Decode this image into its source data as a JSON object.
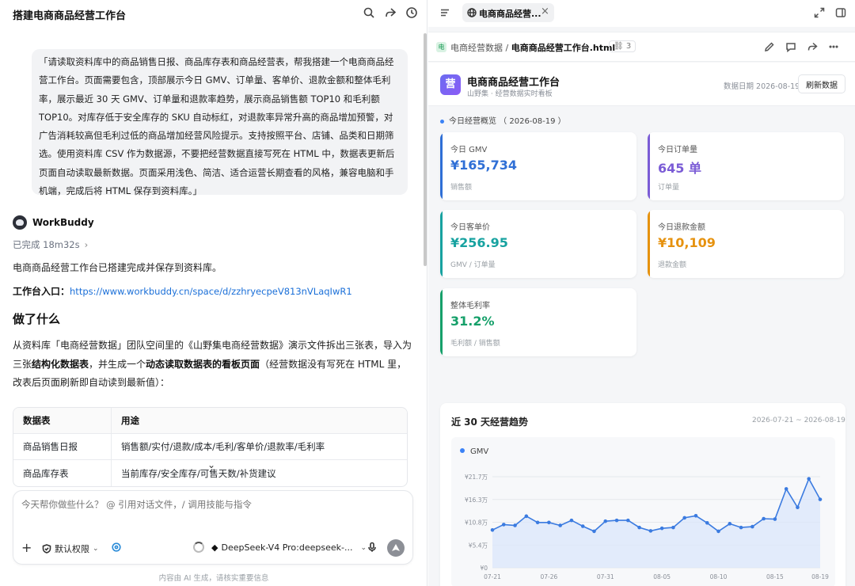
{
  "left": {
    "title": "搭建电商商品经营工作台",
    "prompt": "「请读取资料库中的商品销售日报、商品库存表和商品经营表，帮我搭建一个电商商品经营工作台。页面需要包含，顶部展示今日 GMV、订单量、客单价、退款金额和整体毛利率，展示最近 30 天 GMV、订单量和退款率趋势，展示商品销售额 TOP10 和毛利额 TOP10。对库存低于安全库存的 SKU 自动标红，对退款率异常升高的商品增加预警，对广告消耗较高但毛利过低的商品增加经营风险提示。支持按照平台、店铺、品类和日期筛选。使用资料库 CSV 作为数据源，不要把经营数据直接写死在 HTML 中，数据表更新后页面自动读取最新数据。页面采用浅色、简洁、适合运营长期查看的风格，兼容电脑和手机端，完成后将 HTML 保存到资料库。」",
    "agent_name": "WorkBuddy",
    "status": "已完成 18m32s",
    "message": "电商商品经营工作台已搭建完成并保存到资料库。",
    "entry_label": "工作台入口：",
    "entry_link": "https://www.workbuddy.cn/space/d/zzhryecpeV813nVLaqIwR1",
    "heading": "做了什么",
    "para_1": "从资料库「电商经营数据」团队空间里的《山野集电商经营数据》演示文件拆出三张表，导入为三张",
    "para_bold_1": "结构化数据表",
    "para_2": "，并生成一个",
    "para_bold_2": "动态读取数据表的看板页面",
    "para_3": "（经营数据没有写死在 HTML 里，改表后页面刷新即自动读到最新值）：",
    "table": {
      "headers": [
        "数据表",
        "用途"
      ],
      "rows": [
        [
          "商品销售日报",
          "销售额/实付/退款/成本/毛利/客单价/退款率/毛利率"
        ],
        [
          "商品库存表",
          "当前库存/安全库存/可售天数/补货建议"
        ]
      ]
    },
    "composer": {
      "placeholder": "今天帮你做些什么？ @ 引用对话文件，/ 调用技能与指令",
      "permission": "默认权限",
      "model": "DeepSeek-V4 Pro:deepseek-..."
    },
    "disclaimer": "内容由 AI 生成，请核实重要信息"
  },
  "right": {
    "tab_label": "电商商品经营...",
    "path_folder": "电商经营数据",
    "path_file": "电商商品经营工作台.html",
    "path_count": "3",
    "app_logo": "营",
    "app_title": "电商商品经营工作台",
    "app_subtitle": "山野集 · 经营数据实时看板",
    "data_date": "数据日期 2026-08-19",
    "refresh_label": "刷新数据",
    "overview_title": "今日经营概览 （ 2026-08-19 ）",
    "kpis": [
      {
        "label": "今日 GMV",
        "value": "¥165,734",
        "sub": "销售额",
        "color": "#2f6fd6"
      },
      {
        "label": "今日订单量",
        "value": "645 单",
        "sub": "订单量",
        "color": "#7b5cd6"
      },
      {
        "label": "今日客单价",
        "value": "¥256.95",
        "sub": "GMV / 订单量",
        "color": "#17a2a0"
      },
      {
        "label": "今日退款金额",
        "value": "¥10,109",
        "sub": "退款金额",
        "color": "#e6920f"
      },
      {
        "label": "整体毛利率",
        "value": "31.2%",
        "sub": "毛利额 / 销售额",
        "color": "#16a06a"
      }
    ],
    "trend_title": "近 30 天经营趋势",
    "trend_range": "2026-07-21 ~ 2026-08-19"
  },
  "chart_data": {
    "type": "area",
    "title": "",
    "legend": [
      "GMV"
    ],
    "legend_position": "top-left",
    "x_ticks": [
      "07-21",
      "07-26",
      "07-31",
      "08-05",
      "08-10",
      "08-15",
      "08-19"
    ],
    "y_ticks": [
      "¥0",
      "¥5.4万",
      "¥10.8万",
      "¥16.3万",
      "¥21.7万"
    ],
    "ylim": [
      0,
      21.7
    ],
    "y_unit": "万",
    "grid": true,
    "series": [
      {
        "name": "GMV",
        "x": [
          "07-21",
          "07-22",
          "07-23",
          "07-24",
          "07-25",
          "07-26",
          "07-27",
          "07-28",
          "07-29",
          "07-30",
          "07-31",
          "08-01",
          "08-02",
          "08-03",
          "08-04",
          "08-05",
          "08-06",
          "08-07",
          "08-08",
          "08-09",
          "08-10",
          "08-11",
          "08-12",
          "08-13",
          "08-14",
          "08-15",
          "08-16",
          "08-17",
          "08-18",
          "08-19"
        ],
        "values": [
          9.0,
          10.3,
          10.1,
          12.3,
          10.8,
          10.8,
          10.1,
          11.3,
          9.9,
          8.7,
          11.1,
          11.3,
          11.3,
          9.6,
          8.8,
          9.4,
          9.6,
          11.9,
          12.4,
          10.7,
          8.7,
          10.5,
          9.6,
          9.8,
          11.7,
          11.6,
          18.8,
          14.4,
          21.2,
          16.3
        ]
      }
    ]
  }
}
